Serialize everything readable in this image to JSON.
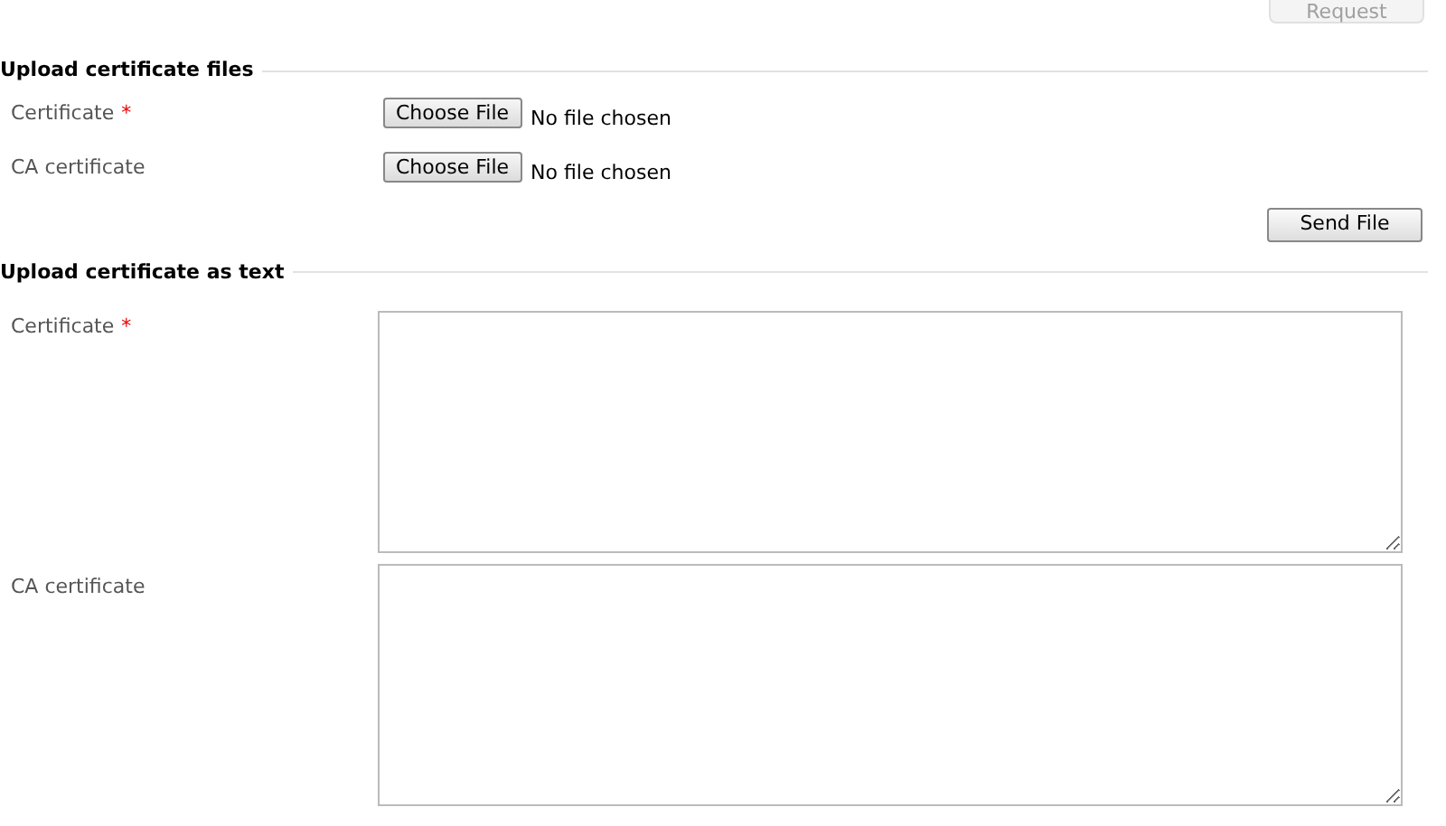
{
  "top_button": {
    "label": "Request",
    "disabled": true
  },
  "file_section": {
    "title": "Upload certificate files",
    "rows": [
      {
        "label": "Certificate",
        "required_mark": "*",
        "button": "Choose File",
        "status": "No file chosen"
      },
      {
        "label": "CA certificate",
        "button": "Choose File",
        "status": "No file chosen"
      }
    ],
    "submit": "Send File"
  },
  "text_section": {
    "title": "Upload certificate as text",
    "rows": [
      {
        "label": "Certificate",
        "required_mark": "*"
      },
      {
        "label": "CA certificate"
      }
    ]
  }
}
